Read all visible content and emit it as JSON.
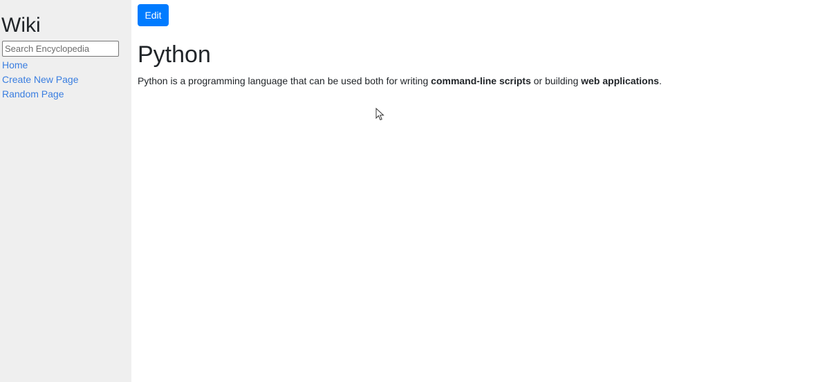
{
  "sidebar": {
    "title": "Wiki",
    "search_placeholder": "Search Encyclopedia",
    "links": [
      {
        "label": "Home"
      },
      {
        "label": "Create New Page"
      },
      {
        "label": "Random Page"
      }
    ]
  },
  "main": {
    "edit_label": "Edit",
    "page_title": "Python",
    "content": {
      "part1": "Python is a programming language that can be used both for writing ",
      "bold1": "command-line scripts",
      "part2": " or building ",
      "bold2": "web applications",
      "part3": "."
    }
  },
  "colors": {
    "sidebar_bg": "#efefef",
    "link": "#3a7ee0",
    "button": "#007bff"
  },
  "icons": {
    "pointer": "mouse-pointer-icon"
  }
}
